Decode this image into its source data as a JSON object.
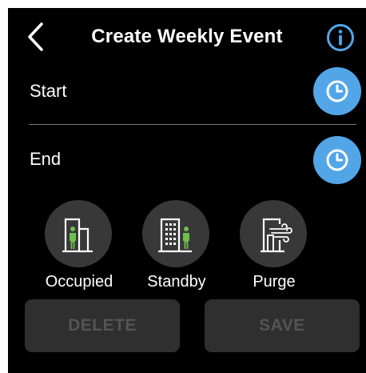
{
  "header": {
    "back_icon": "chevron-left-icon",
    "title": "Create Weekly Event",
    "info_icon": "info-icon"
  },
  "start": {
    "label": "Start",
    "icon": "clock-icon"
  },
  "end": {
    "label": "End",
    "icon": "clock-icon"
  },
  "modes": [
    {
      "label": "Occupied",
      "icon": "occupied-building-icon"
    },
    {
      "label": "Standby",
      "icon": "standby-building-icon"
    },
    {
      "label": "Purge",
      "icon": "purge-icon"
    }
  ],
  "actions": {
    "delete_label": "DELETE",
    "save_label": "SAVE"
  },
  "colors": {
    "background": "#000000",
    "accent_blue": "#52a6e8",
    "mode_circle": "#383838",
    "person_green": "#6fbf4a",
    "button_disabled_bg": "#2f2f2f",
    "button_disabled_text": "#545454"
  }
}
